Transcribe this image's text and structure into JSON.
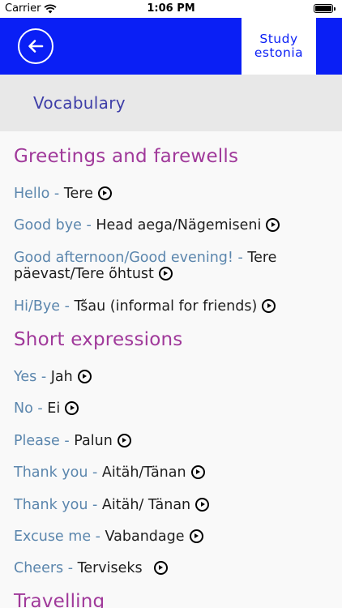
{
  "status_bar": {
    "carrier": "Carrier",
    "time": "1:06 PM",
    "battery_level": 1.0
  },
  "header": {
    "brand_line1": "Study",
    "brand_line2": "estonia",
    "back_icon": "arrow-left-icon",
    "color": "#0a1ff5"
  },
  "section": {
    "title": "Vocabulary"
  },
  "categories": [
    {
      "title": "Greetings and farewells"
    },
    {
      "title": "Short expressions"
    },
    {
      "title": "Travelling"
    }
  ],
  "phrases": [
    {
      "en": "Hello",
      "sep": " - ",
      "et": "Tere"
    },
    {
      "en": "Good bye",
      "sep": " - ",
      "et": "Head aega/Nägemiseni"
    },
    {
      "en": "Good afternoon/Good evening!",
      "sep": " - ",
      "et": "Tere päevast/Tere õhtust"
    },
    {
      "en": "Hi/Bye",
      "sep": " - ",
      "et": "Tšau (informal for friends)"
    },
    {
      "en": "Yes",
      "sep": " - ",
      "et": "Jah"
    },
    {
      "en": "No",
      "sep": " - ",
      "et": "Ei"
    },
    {
      "en": "Please",
      "sep": " - ",
      "et": "Palun"
    },
    {
      "en": "Thank you",
      "sep": " - ",
      "et": "Aitäh/Tänan"
    },
    {
      "en": "Thank you",
      "sep": " - ",
      "et": "Aitäh/ Tänan"
    },
    {
      "en": "Excuse me",
      "sep": " - ",
      "et": "Vabandage"
    },
    {
      "en": "Cheers",
      "sep": " - ",
      "et": "Terviseks"
    }
  ],
  "colors": {
    "category": "#a0399a",
    "english": "#5b86ad",
    "estonian": "#1e1e1e",
    "section_title": "#3e3ea8"
  }
}
